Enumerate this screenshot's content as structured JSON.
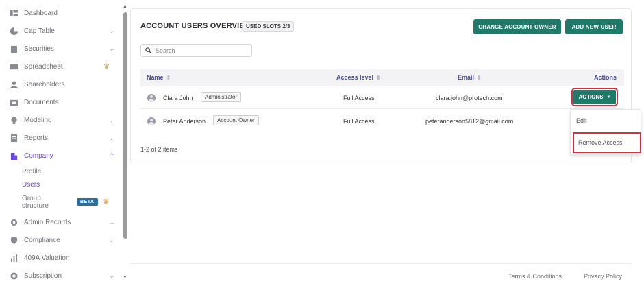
{
  "sidebar": {
    "items": [
      {
        "label": "Dashboard",
        "icon": "dashboard-icon",
        "chevron": false
      },
      {
        "label": "Cap Table",
        "icon": "pie-chart-icon",
        "chevron": true
      },
      {
        "label": "Securities",
        "icon": "clipboard-icon",
        "chevron": true
      },
      {
        "label": "Spreadsheet",
        "icon": "spreadsheet-icon",
        "chevron": false,
        "crown": true
      },
      {
        "label": "Shareholders",
        "icon": "user-icon",
        "chevron": false
      },
      {
        "label": "Documents",
        "icon": "folder-icon",
        "chevron": false
      },
      {
        "label": "Modeling",
        "icon": "lightbulb-icon",
        "chevron": true
      },
      {
        "label": "Reports",
        "icon": "report-icon",
        "chevron": true
      },
      {
        "label": "Company",
        "icon": "building-icon",
        "chevron": true,
        "active": true
      },
      {
        "label": "Admin Records",
        "icon": "gear-icon",
        "chevron": true
      },
      {
        "label": "Compliance",
        "icon": "shield-icon",
        "chevron": true
      },
      {
        "label": "409A Valuation",
        "icon": "valuation-icon",
        "chevron": false
      },
      {
        "label": "Subscription",
        "icon": "coin-icon",
        "chevron": true
      }
    ],
    "company_sub": {
      "profile": "Profile",
      "users": "Users",
      "group_structure_line1": "Group",
      "group_structure_line2": "structure",
      "beta": "BETA"
    },
    "crown_glyph": "♛"
  },
  "main": {
    "title": "ACCOUNT USERS OVERVIEW",
    "slots": "USED SLOTS 2/3",
    "change_owner_label": "CHANGE ACCOUNT OWNER",
    "add_user_label": "ADD NEW USER",
    "search_placeholder": "Search",
    "columns": {
      "name": "Name",
      "access": "Access level",
      "email": "Email",
      "actions": "Actions"
    },
    "rows": [
      {
        "name": "Clara John",
        "role": "Administrator",
        "access": "Full Access",
        "email": "clara.john@protech.com",
        "actions_label": "ACTIONS"
      },
      {
        "name": "Peter Anderson",
        "role": "Account Owner",
        "access": "Full Access",
        "email": "peteranderson5812@gmail.com"
      }
    ],
    "pager": "1-2 of 2 items",
    "dropdown": {
      "edit": "Edit",
      "remove": "Remove Access"
    }
  },
  "footer": {
    "terms": "Terms & Conditions",
    "privacy": "Privacy Policy"
  },
  "colors": {
    "accent": "#6a4ad8",
    "primary_button": "#1f7a6a",
    "highlight": "#d32f3f",
    "beta": "#2d6f9a"
  }
}
